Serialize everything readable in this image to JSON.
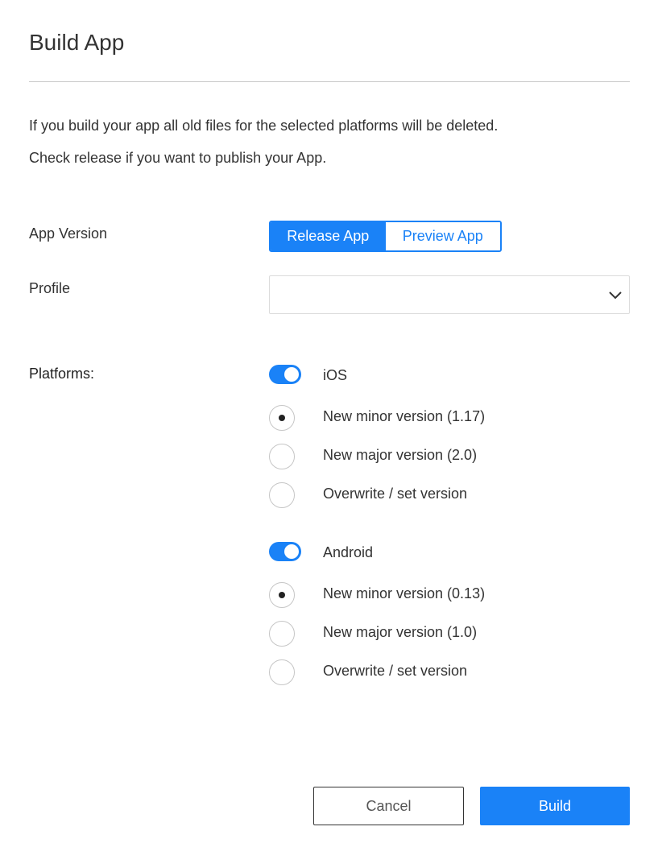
{
  "dialog": {
    "title": "Build App",
    "description_line1": "If you build your app all old files for the selected platforms will be deleted.",
    "description_line2": "Check release if you want to publish your App."
  },
  "app_version": {
    "label": "App Version",
    "options": [
      "Release App",
      "Preview App"
    ],
    "selected": "Release App"
  },
  "profile": {
    "label": "Profile",
    "value": ""
  },
  "platforms": {
    "label": "Platforms:",
    "ios": {
      "name": "iOS",
      "enabled": true,
      "options": [
        "New minor version (1.17)",
        "New major version (2.0)",
        "Overwrite / set version"
      ],
      "selected": "New minor version (1.17)"
    },
    "android": {
      "name": "Android",
      "enabled": true,
      "options": [
        "New minor version (0.13)",
        "New major version (1.0)",
        "Overwrite / set version"
      ],
      "selected": "New minor version (0.13)"
    }
  },
  "footer": {
    "cancel_label": "Cancel",
    "build_label": "Build"
  },
  "colors": {
    "accent": "#1a82f7"
  }
}
